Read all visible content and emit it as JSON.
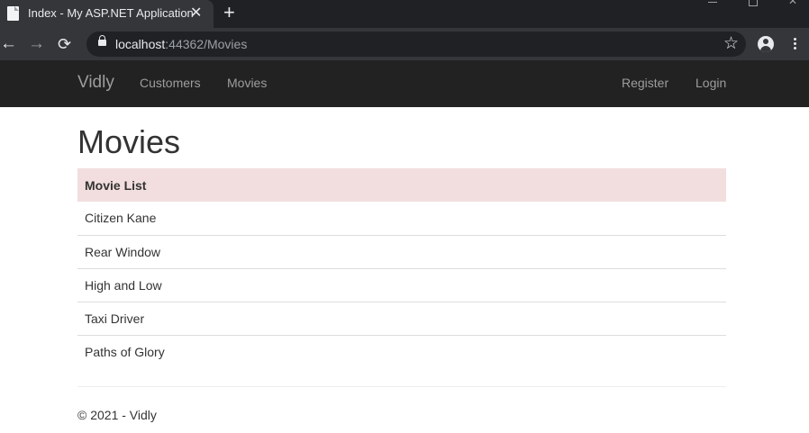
{
  "browser": {
    "tab_title": "Index - My ASP.NET Application",
    "tab_close": "✕",
    "new_tab": "+",
    "url_host": "localhost",
    "url_rest": ":44362/Movies",
    "back_icon": "←",
    "forward_icon": "→",
    "reload_icon": "⟳",
    "star_icon": "☆",
    "close_window": "✕"
  },
  "navbar": {
    "brand": "Vidly",
    "links": [
      "Customers",
      "Movies"
    ],
    "right_links": [
      "Register",
      "Login"
    ]
  },
  "main": {
    "title": "Movies",
    "table_header": "Movie List",
    "movies": [
      "Citizen Kane",
      "Rear Window",
      "High and Low",
      "Taxi Driver",
      "Paths of Glory"
    ]
  },
  "footer": {
    "text": "© 2021 - Vidly"
  },
  "colors": {
    "navbar_bg": "#222222",
    "header_row_bg": "#f2dede"
  }
}
